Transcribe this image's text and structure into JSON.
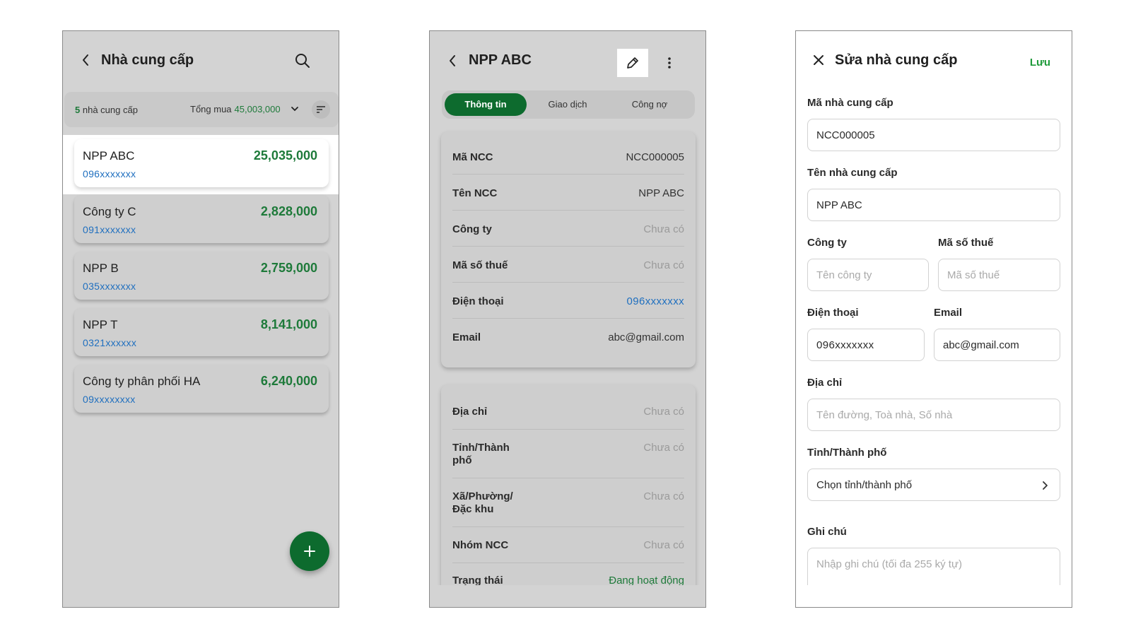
{
  "screen1": {
    "title": "Nhà cung cấp",
    "summary": {
      "count": "5",
      "count_suffix": "nhà cung cấp",
      "total_label": "Tổng mua",
      "total_value": "45,003,000"
    },
    "suppliers": [
      {
        "name": "NPP ABC",
        "phone": "096xxxxxxx",
        "amount": "25,035,000"
      },
      {
        "name": "Công ty C",
        "phone": "091xxxxxxx",
        "amount": "2,828,000"
      },
      {
        "name": "NPP B",
        "phone": "035xxxxxxx",
        "amount": "2,759,000"
      },
      {
        "name": "NPP T",
        "phone": "0321xxxxxx",
        "amount": "8,141,000"
      },
      {
        "name": "Công ty phân phối HA",
        "phone": "09xxxxxxxx",
        "amount": "6,240,000"
      }
    ]
  },
  "screen2": {
    "title": "NPP ABC",
    "tabs": [
      "Thông tin",
      "Giao dịch",
      "Công nợ"
    ],
    "info": [
      {
        "label": "Mã NCC",
        "value": "NCC000005"
      },
      {
        "label": "Tên NCC",
        "value": "NPP ABC"
      },
      {
        "label": "Công ty",
        "value": "Chưa có"
      },
      {
        "label": "Mã số thuế",
        "value": "Chưa có"
      },
      {
        "label": "Điện thoại",
        "value": "096xxxxxxx"
      },
      {
        "label": "Email",
        "value": "abc@gmail.com"
      }
    ],
    "address": [
      {
        "label": "Địa chỉ",
        "value": "Chưa có"
      },
      {
        "label": "Tỉnh/Thành phố",
        "value": "Chưa có"
      },
      {
        "label": "Xã/Phường/ Đặc khu",
        "value": "Chưa có"
      },
      {
        "label": "Nhóm NCC",
        "value": "Chưa có"
      },
      {
        "label": "Trạng thái",
        "value": "Đang hoạt động"
      }
    ]
  },
  "screen3": {
    "title": "Sửa nhà cung cấp",
    "save_label": "Lưu",
    "fields": {
      "code": {
        "label": "Mã nhà cung cấp",
        "value": "NCC000005"
      },
      "name": {
        "label": "Tên nhà cung cấp",
        "value": "NPP ABC"
      },
      "company": {
        "label": "Công ty",
        "placeholder": "Tên công ty"
      },
      "tax": {
        "label": "Mã số thuế",
        "placeholder": "Mã số thuế"
      },
      "phone": {
        "label": "Điện thoại",
        "value": "096xxxxxxx"
      },
      "email": {
        "label": "Email",
        "value": "abc@gmail.com"
      },
      "address": {
        "label": "Địa chỉ",
        "placeholder": "Tên đường, Toà nhà, Số nhà"
      },
      "province": {
        "label": "Tỉnh/Thành phố",
        "value": "Chọn tỉnh/thành phố"
      },
      "note": {
        "label": "Ghi chú",
        "placeholder": "Nhập ghi chú (tối đa 255 ký tự)"
      }
    }
  },
  "colors": {
    "primary_green": "#0d6b2e",
    "amount_green": "#1e7a3a",
    "phone_blue": "#1f6fbf",
    "screen_gray": "#d3d3d3"
  },
  "icons": [
    "chevron-left-icon",
    "search-icon",
    "chevron-down-icon",
    "filter-icon",
    "plus-icon",
    "pencil-icon",
    "more-vertical-icon",
    "close-icon",
    "chevron-right-icon"
  ]
}
